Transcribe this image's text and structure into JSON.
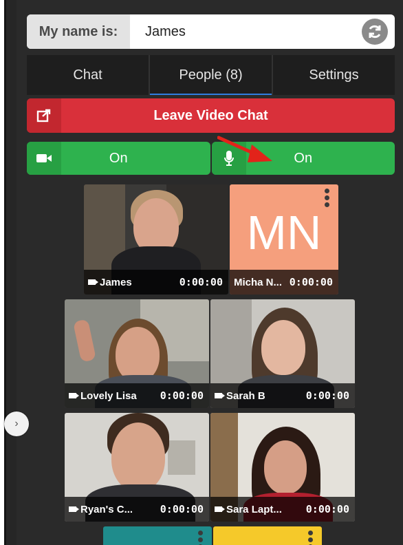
{
  "name_bar": {
    "label": "My name is:",
    "value": "James"
  },
  "tabs": [
    {
      "label": "Chat",
      "active": false
    },
    {
      "label": "People (8)",
      "active": true
    },
    {
      "label": "Settings",
      "active": false
    }
  ],
  "leave_button": {
    "label": "Leave Video Chat"
  },
  "camera_toggle": {
    "label": "On",
    "icon": "video-camera-icon"
  },
  "mic_toggle": {
    "label": "On",
    "icon": "microphone-icon"
  },
  "participants": [
    {
      "name": "James",
      "timer": "0:00:00"
    },
    {
      "name": "Micha N...",
      "timer": "0:00:00",
      "initials": "MN",
      "color": "#f59f7d"
    },
    {
      "name": "Lovely Lisa",
      "timer": "0:00:00"
    },
    {
      "name": "Sarah B",
      "timer": "0:00:00"
    },
    {
      "name": "Ryan's C...",
      "timer": "0:00:00"
    },
    {
      "name": "Sara Lapt...",
      "timer": "0:00:00"
    }
  ],
  "partial_tiles": [
    {
      "color": "#1f8c8c"
    },
    {
      "color": "#f5c92a"
    }
  ],
  "colors": {
    "leave": "#d9303a",
    "on": "#2eb24e",
    "tab_active": "#2f7de1",
    "arrow": "#e2231a"
  }
}
